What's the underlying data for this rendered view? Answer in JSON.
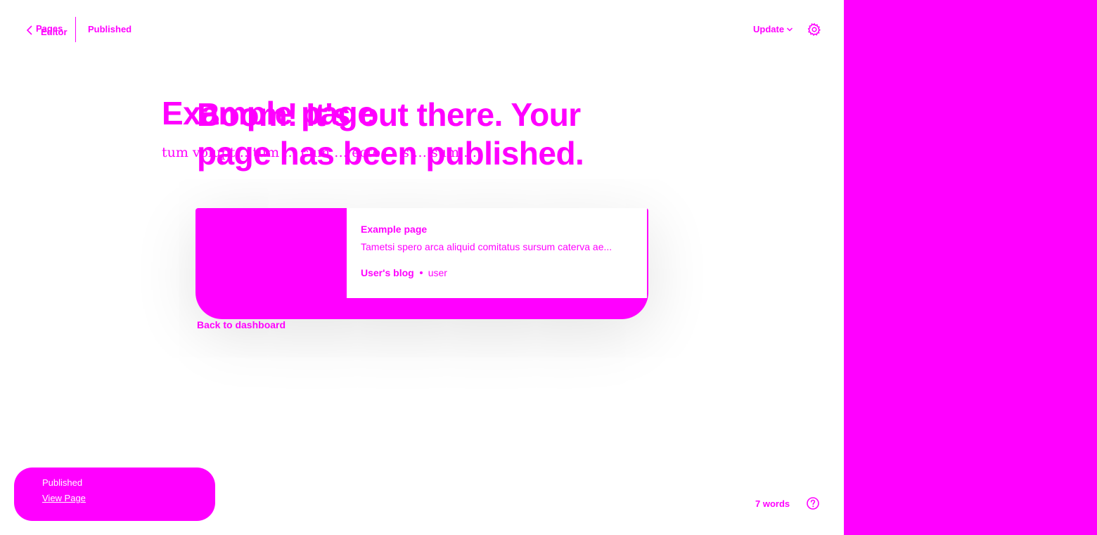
{
  "topbar": {
    "back_label_1": "Pages",
    "back_label_2": "Editor",
    "back_icon": "chevron-left-icon",
    "status": "Published",
    "update_label": "Update",
    "update_icon": "chevron-down-icon",
    "settings_icon": "gear-icon"
  },
  "document": {
    "title": "Example page",
    "body": "tum volupt… tum … cum … ecto … s … sum …"
  },
  "success": {
    "heading": "Boom! It's out there. Your page has been published.",
    "card": {
      "title": "Example page",
      "excerpt": "Tametsi spero arca aliquid comitatus sursum caterva ae...",
      "blog": "User's blog",
      "author": "user"
    },
    "back_link": "Back to dashboard"
  },
  "status_pill": {
    "status": "Published",
    "link": "View Page"
  },
  "footer": {
    "word_count": "7 words",
    "help_icon": "help-icon"
  },
  "colors": {
    "accent": "#ff00ff",
    "background": "#ffffff",
    "pill_text": "#ffffff"
  }
}
